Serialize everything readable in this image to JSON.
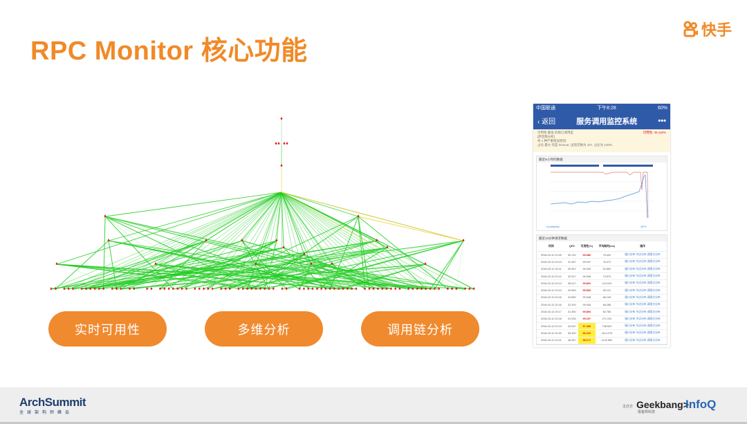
{
  "slide": {
    "title": "RPC Monitor 核心功能",
    "brand": "快手",
    "features": [
      "实时可用性",
      "多维分析",
      "调用链分析"
    ]
  },
  "phone": {
    "status": {
      "carrier": "中国联通",
      "time": "下午8:28",
      "battery": "60%"
    },
    "nav": {
      "back": "返回",
      "title": "服务调用监控系统",
      "more": "•••"
    },
    "notice": [
      "可用性 最低 的接口调用是",
      "[原因猜分析]",
      "共 1 种严重错误原因:",
      "占比 最大 的是 timeout, 出现次数为 157, 占比为 100%."
    ],
    "notice_right": "可用性: 45.116%",
    "chart_panel_title": "最近N小时的数据",
    "chart_legend": [
      "Availability",
      "QPS"
    ],
    "chart_note": "关于数据的统计, 可能不包含最近一分钟数据",
    "table_panel_title": "最近10分钟请求数据",
    "table_headers": [
      "时间",
      "QPS",
      "可用性(%)",
      "平均耗时(ms)",
      "操作"
    ],
    "table_rows": [
      {
        "time": "2018-03-12 20:09",
        "qps": "30.132",
        "avail": "99.686",
        "cost": "75.432",
        "flag": "red"
      },
      {
        "time": "2018-03-12 20:10",
        "qps": "31.367",
        "avail": "99.947",
        "cost": "76.472",
        "flag": ""
      },
      {
        "time": "2018-03-12 20:11",
        "qps": "30.967",
        "avail": "99.945",
        "cost": "52.852",
        "flag": ""
      },
      {
        "time": "2018-03-12 20:12",
        "qps": "32.517",
        "avail": "99.946",
        "cost": "73.570",
        "flag": ""
      },
      {
        "time": "2018-03-12 20:13",
        "qps": "36.017",
        "avail": "99.891",
        "cost": "113.019",
        "flag": "red"
      },
      {
        "time": "2018-03-12 20:14",
        "qps": "29.983",
        "avail": "99.833",
        "cost": "95.121",
        "flag": "red"
      },
      {
        "time": "2018-03-12 20:15",
        "qps": "31.850",
        "avail": "99.948",
        "cost": "68.149",
        "flag": ""
      },
      {
        "time": "2018-03-12 20:16",
        "qps": "32.200",
        "avail": "99.946",
        "cost": "66.286",
        "flag": ""
      },
      {
        "time": "2018-03-12 20:17",
        "qps": "31.350",
        "avail": "99.894",
        "cost": "82.780",
        "flag": "red"
      },
      {
        "time": "2018-03-12 20:18",
        "qps": "31.933",
        "avail": "99.157",
        "cost": "271.310",
        "flag": "red"
      },
      {
        "time": "2018-03-12 20:19",
        "qps": "34.067",
        "avail": "97.456",
        "cost": "738.529",
        "flag": "hl"
      },
      {
        "time": "2018-03-12 20:20",
        "qps": "35.300",
        "avail": "96.223",
        "cost": "1114.275",
        "flag": "hl"
      },
      {
        "time": "2018-03-12 20:21",
        "qps": "36.067",
        "avail": "98.171",
        "cost": "1142.552",
        "flag": "hl"
      }
    ],
    "table_ops": [
      "接口分布",
      "节点分布",
      "调用方分布"
    ]
  },
  "footer": {
    "conference": "ArchSummit",
    "conference_sub": "全球架构师峰会",
    "sponsor_label": "主办方",
    "geekbang": "Geekbang>.",
    "geekbang_sub": "极客邦科技",
    "infoq": "InfoQ"
  }
}
